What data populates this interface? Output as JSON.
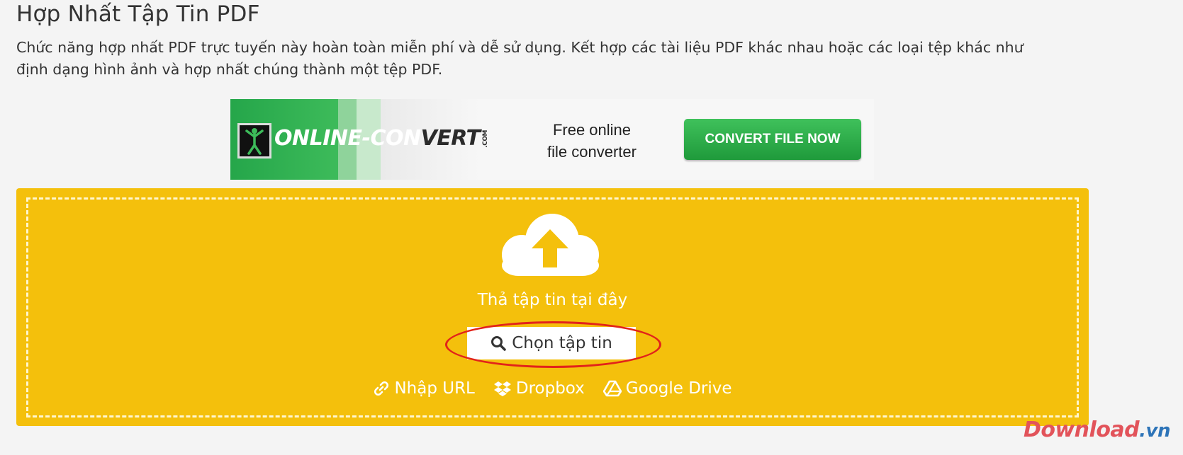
{
  "page": {
    "title": "Hợp Nhất Tập Tin PDF",
    "description": "Chức năng hợp nhất PDF trực tuyến này hoàn toàn miễn phí và dễ sử dụng. Kết hợp các tài liệu PDF khác nhau hoặc các loại tệp khác như định dạng hình ảnh và hợp nhất chúng thành một tệp PDF."
  },
  "ad": {
    "logo_main": "ONLINE-CON",
    "logo_tail": "VERT",
    "logo_com": ".COM",
    "tagline_line1": "Free online",
    "tagline_line2": "file converter",
    "button": "CONVERT FILE NOW"
  },
  "upload": {
    "drop_text": "Thả tập tin tại đây",
    "choose_button": "Chọn tập tin",
    "sources": [
      {
        "label": "Nhập URL",
        "icon": "link-icon"
      },
      {
        "label": "Dropbox",
        "icon": "dropbox-icon"
      },
      {
        "label": "Google Drive",
        "icon": "google-drive-icon"
      }
    ]
  },
  "watermark": {
    "brand": "Download",
    "domain": ".vn"
  },
  "colors": {
    "dropzone": "#f4c00c",
    "highlight": "#e2231a",
    "ad_green": "#25a64a"
  }
}
